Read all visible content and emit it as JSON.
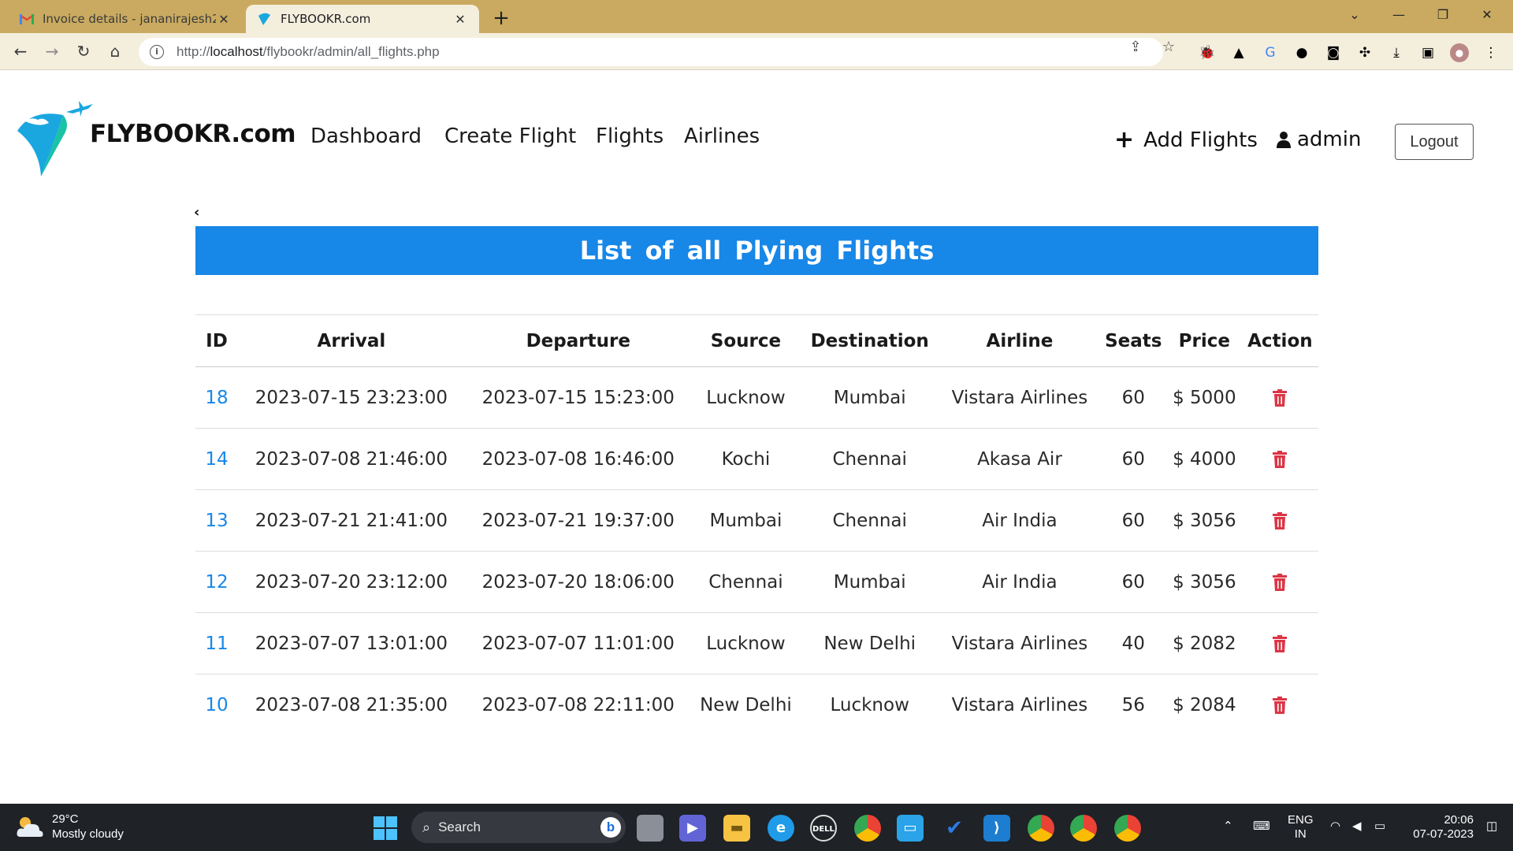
{
  "browser": {
    "tabs": [
      {
        "title": "Invoice details - jananirajesh2702",
        "active": false,
        "icon": "gmail-icon"
      },
      {
        "title": "FLYBOOKR.com",
        "active": true,
        "icon": "flybookr-favicon"
      }
    ],
    "url_prefix": "http://",
    "url_host": "localhost",
    "url_path": "/flybookr/admin/all_flights.php"
  },
  "site": {
    "brand": "FLYBOOKR.com",
    "nav": [
      "Dashboard",
      "Create Flight",
      "Flights",
      "Airlines"
    ],
    "add_flights": "Add Flights",
    "user": "admin",
    "logout": "Logout"
  },
  "page": {
    "back": "‹",
    "banner": "List of all Plying Flights"
  },
  "table": {
    "headers": [
      "ID",
      "Arrival",
      "Departure",
      "Source",
      "Destination",
      "Airline",
      "Seats",
      "Price",
      "Action"
    ],
    "rows": [
      {
        "id": "18",
        "arrival": "2023-07-15 23:23:00",
        "departure": "2023-07-15 15:23:00",
        "source": "Lucknow",
        "destination": "Mumbai",
        "airline": "Vistara Airlines",
        "seats": "60",
        "price": "$ 5000"
      },
      {
        "id": "14",
        "arrival": "2023-07-08 21:46:00",
        "departure": "2023-07-08 16:46:00",
        "source": "Kochi",
        "destination": "Chennai",
        "airline": "Akasa Air",
        "seats": "60",
        "price": "$ 4000"
      },
      {
        "id": "13",
        "arrival": "2023-07-21 21:41:00",
        "departure": "2023-07-21 19:37:00",
        "source": "Mumbai",
        "destination": "Chennai",
        "airline": "Air India",
        "seats": "60",
        "price": "$ 3056"
      },
      {
        "id": "12",
        "arrival": "2023-07-20 23:12:00",
        "departure": "2023-07-20 18:06:00",
        "source": "Chennai",
        "destination": "Mumbai",
        "airline": "Air India",
        "seats": "60",
        "price": "$ 3056"
      },
      {
        "id": "11",
        "arrival": "2023-07-07 13:01:00",
        "departure": "2023-07-07 11:01:00",
        "source": "Lucknow",
        "destination": "New Delhi",
        "airline": "Vistara Airlines",
        "seats": "40",
        "price": "$ 2082"
      },
      {
        "id": "10",
        "arrival": "2023-07-08 21:35:00",
        "departure": "2023-07-08 22:11:00",
        "source": "New Delhi",
        "destination": "Lucknow",
        "airline": "Vistara Airlines",
        "seats": "56",
        "price": "$ 2084"
      }
    ]
  },
  "taskbar": {
    "temperature": "29°C",
    "weather": "Mostly cloudy",
    "search": "Search",
    "lang_1": "ENG",
    "lang_2": "IN",
    "time": "20:06",
    "date": "07-07-2023"
  },
  "colors": {
    "accent": "#1787e8",
    "delete": "#dc3545",
    "tabstrip": "#c9aa60",
    "toolbar": "#f4eedd",
    "taskbar": "#1f2227"
  }
}
